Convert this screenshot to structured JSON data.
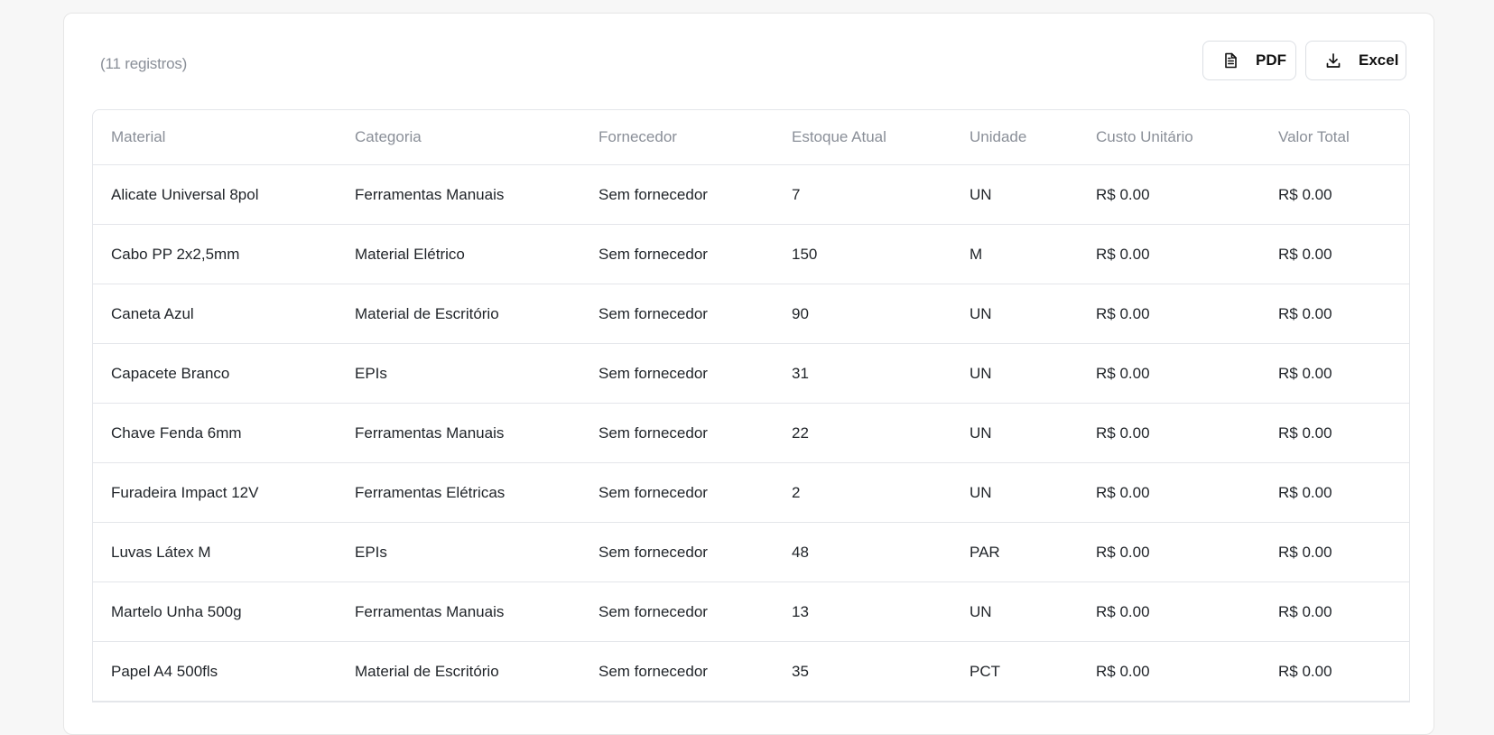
{
  "summary": {
    "count_text": "(11 registros)"
  },
  "actions": {
    "pdf_label": "PDF",
    "excel_label": "Excel"
  },
  "table": {
    "headers": [
      "Material",
      "Categoria",
      "Fornecedor",
      "Estoque Atual",
      "Unidade",
      "Custo Unitário",
      "Valor Total"
    ],
    "rows": [
      [
        "Alicate Universal 8pol",
        "Ferramentas Manuais",
        "Sem fornecedor",
        "7",
        "UN",
        "R$ 0.00",
        "R$ 0.00"
      ],
      [
        "Cabo PP 2x2,5mm",
        "Material Elétrico",
        "Sem fornecedor",
        "150",
        "M",
        "R$ 0.00",
        "R$ 0.00"
      ],
      [
        "Caneta Azul",
        "Material de Escritório",
        "Sem fornecedor",
        "90",
        "UN",
        "R$ 0.00",
        "R$ 0.00"
      ],
      [
        "Capacete Branco",
        "EPIs",
        "Sem fornecedor",
        "31",
        "UN",
        "R$ 0.00",
        "R$ 0.00"
      ],
      [
        "Chave Fenda 6mm",
        "Ferramentas Manuais",
        "Sem fornecedor",
        "22",
        "UN",
        "R$ 0.00",
        "R$ 0.00"
      ],
      [
        "Furadeira Impact 12V",
        "Ferramentas Elétricas",
        "Sem fornecedor",
        "2",
        "UN",
        "R$ 0.00",
        "R$ 0.00"
      ],
      [
        "Luvas Látex M",
        "EPIs",
        "Sem fornecedor",
        "48",
        "PAR",
        "R$ 0.00",
        "R$ 0.00"
      ],
      [
        "Martelo Unha 500g",
        "Ferramentas Manuais",
        "Sem fornecedor",
        "13",
        "UN",
        "R$ 0.00",
        "R$ 0.00"
      ],
      [
        "Papel A4 500fls",
        "Material de Escritório",
        "Sem fornecedor",
        "35",
        "PCT",
        "R$ 0.00",
        "R$ 0.00"
      ]
    ]
  },
  "icons": {
    "pdf": "document-icon",
    "excel": "download-icon"
  }
}
